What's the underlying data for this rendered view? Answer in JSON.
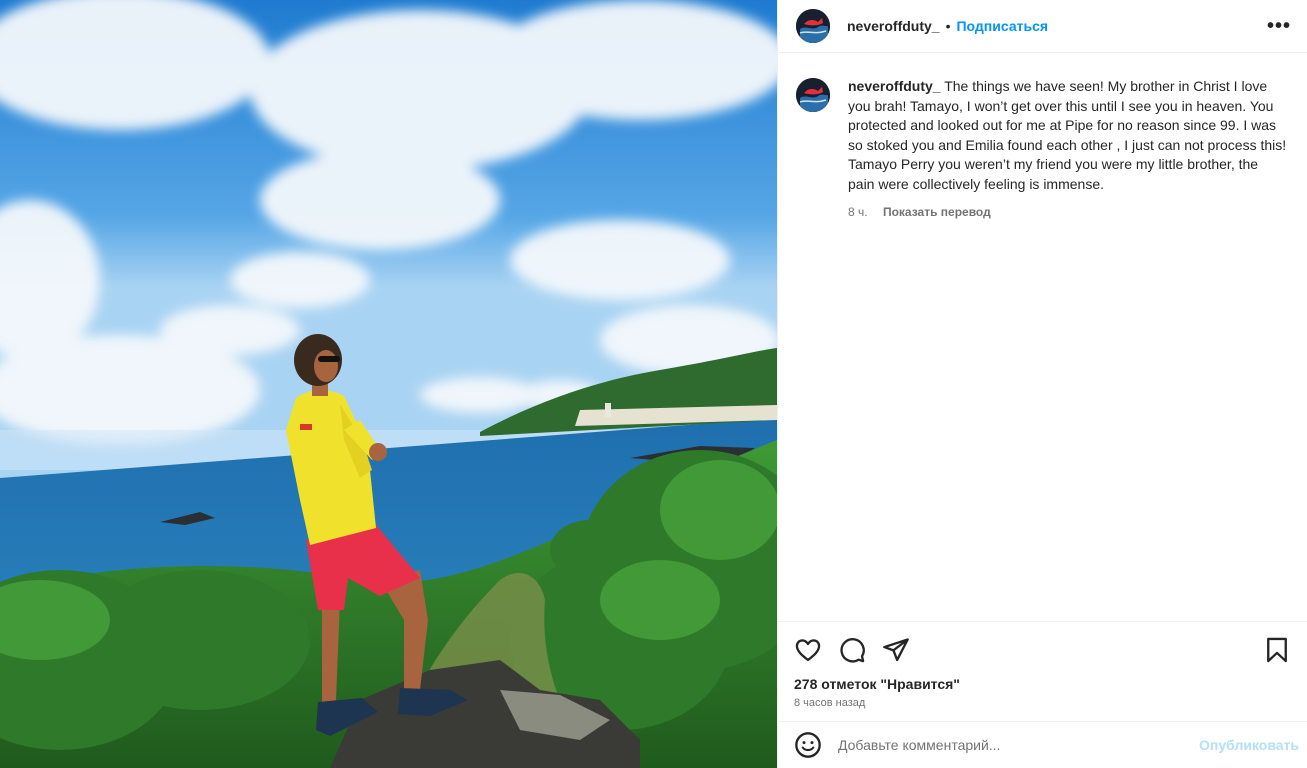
{
  "post": {
    "username": "neveroffduty_",
    "dot": "•",
    "follow_label": "Подписаться",
    "more_label": "•••",
    "caption": "The things we have seen! My brother in Christ I love you brah! Tamayo, I won’t get over this until I see you in heaven. You protected and looked out for me at Pipe for no reason since 99. I was so stoked you and Emilia found each other , I just can not process this! Tamayo Perry you weren’t my friend you were my little brother, the pain were collectively feeling is immense.",
    "caption_age": "8 ч.",
    "translate_label": "Показать перевод",
    "likes": "278 отметок \"Нравится\"",
    "posted_ago": "8 часов назад"
  },
  "comment_box": {
    "placeholder": "Добавьте комментарий...",
    "post_label": "Опубликовать"
  },
  "icons": {
    "like": "heart-icon",
    "comment": "comment-icon",
    "share": "send-icon",
    "save": "bookmark-icon",
    "emoji": "emoji-icon",
    "more": "more-icon"
  },
  "colors": {
    "link": "#0095f6",
    "post_disabled": "#b2dffc",
    "muted": "#737373"
  }
}
